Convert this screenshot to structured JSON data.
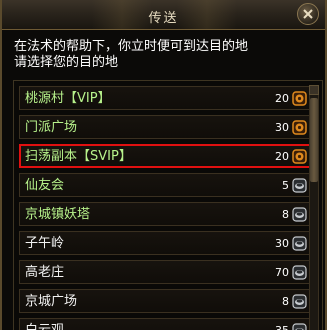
{
  "window": {
    "title": "传送"
  },
  "description": {
    "line1": "在法术的帮助下，你立时便可到达目的地",
    "line2": "请选择您的目的地"
  },
  "colors": {
    "green_label": "#b7f28b",
    "white_label": "#f2f2f2",
    "selected_border": "#e01010",
    "icon_orange": "#e08a1e",
    "icon_silver": "#c8ccd0"
  },
  "destinations": [
    {
      "label": "桃源村【VIP】",
      "cost": "20",
      "label_color": "green",
      "icon": "gold-coin-icon",
      "selected": false
    },
    {
      "label": "门派广场",
      "cost": "30",
      "label_color": "green",
      "icon": "gold-coin-icon",
      "selected": false
    },
    {
      "label": "扫荡副本【SVIP】",
      "cost": "20",
      "label_color": "green",
      "icon": "gold-coin-icon",
      "selected": true
    },
    {
      "label": "仙友会",
      "cost": "5",
      "label_color": "green",
      "icon": "silver-coin-icon",
      "selected": false
    },
    {
      "label": "京城镇妖塔",
      "cost": "8",
      "label_color": "green",
      "icon": "silver-coin-icon",
      "selected": false
    },
    {
      "label": "子午岭",
      "cost": "30",
      "label_color": "white",
      "icon": "silver-coin-icon",
      "selected": false
    },
    {
      "label": "高老庄",
      "cost": "70",
      "label_color": "white",
      "icon": "silver-coin-icon",
      "selected": false
    },
    {
      "label": "京城广场",
      "cost": "8",
      "label_color": "white",
      "icon": "silver-coin-icon",
      "selected": false
    },
    {
      "label": "白云观",
      "cost": "35",
      "label_color": "white",
      "icon": "silver-coin-icon",
      "selected": false
    }
  ]
}
